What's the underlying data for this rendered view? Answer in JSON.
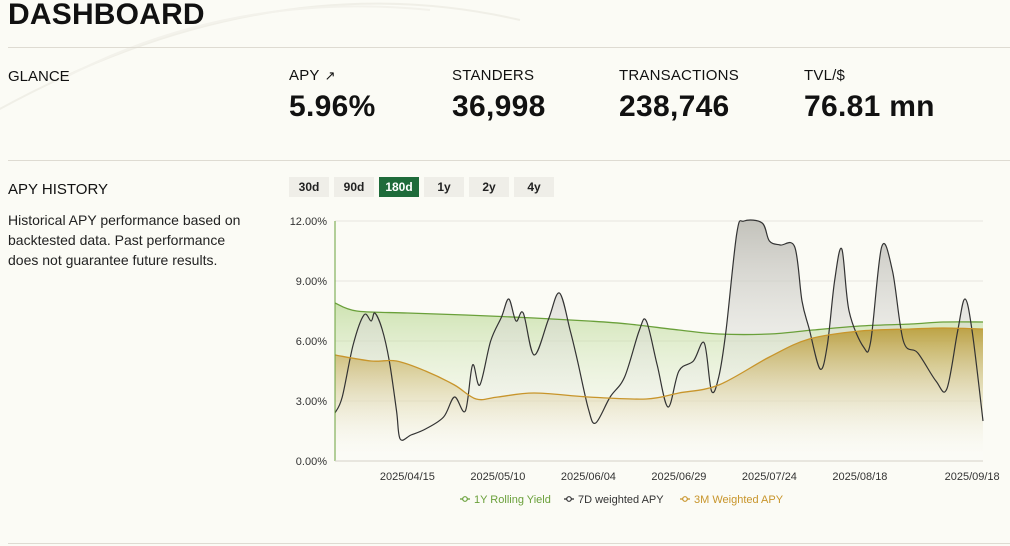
{
  "header": {
    "title": "DASHBOARD"
  },
  "glance": {
    "label": "GLANCE",
    "stats": [
      {
        "label": "APY",
        "icon": "arrow-up-right-icon",
        "value": "5.96%"
      },
      {
        "label": "STANDERS",
        "value": "36,998"
      },
      {
        "label": "TRANSACTIONS",
        "value": "238,746"
      },
      {
        "label": "TVL/$",
        "value": "76.81 mn"
      }
    ]
  },
  "history": {
    "label": "APY HISTORY",
    "description": "Historical APY performance based on backtested data. Past performance does not guarantee future results.",
    "ranges": [
      "30d",
      "90d",
      "180d",
      "1y",
      "2y",
      "4y"
    ],
    "active_range": "180d"
  },
  "colors": {
    "accent": "#1e6b3a",
    "rolling": "#6aa03a",
    "weighted7d": "#333333",
    "weighted3m": "#c8952b"
  },
  "chart_data": {
    "type": "line",
    "x_range": [
      "2025-03-26",
      "2025-09-21"
    ],
    "x_ticks": [
      "2025/04/15",
      "2025/05/10",
      "2025/06/04",
      "2025/06/29",
      "2025/07/24",
      "2025/08/18",
      "2025/09/18"
    ],
    "y_ticks": [
      "0.00%",
      "3.00%",
      "6.00%",
      "9.00%",
      "12.00%"
    ],
    "ylim": [
      0,
      12
    ],
    "legend_position": "bottom",
    "series": [
      {
        "name": "1Y Rolling Yield",
        "points": [
          [
            "2025-03-26",
            7.9
          ],
          [
            "2025-04-01",
            7.5
          ],
          [
            "2025-04-15",
            7.4
          ],
          [
            "2025-05-01",
            7.3
          ],
          [
            "2025-05-20",
            7.15
          ],
          [
            "2025-06-04",
            7.0
          ],
          [
            "2025-06-15",
            6.85
          ],
          [
            "2025-06-29",
            6.55
          ],
          [
            "2025-07-10",
            6.35
          ],
          [
            "2025-07-24",
            6.35
          ],
          [
            "2025-08-05",
            6.55
          ],
          [
            "2025-08-18",
            6.75
          ],
          [
            "2025-09-01",
            6.85
          ],
          [
            "2025-09-10",
            6.95
          ],
          [
            "2025-09-21",
            6.95
          ]
        ]
      },
      {
        "name": "7D weighted APY",
        "points": [
          [
            "2025-03-26",
            2.4
          ],
          [
            "2025-03-28",
            3.2
          ],
          [
            "2025-03-31",
            5.8
          ],
          [
            "2025-04-03",
            7.3
          ],
          [
            "2025-04-05",
            7.0
          ],
          [
            "2025-04-06",
            7.4
          ],
          [
            "2025-04-08",
            6.6
          ],
          [
            "2025-04-10",
            5.0
          ],
          [
            "2025-04-12",
            2.5
          ],
          [
            "2025-04-13",
            1.1
          ],
          [
            "2025-04-16",
            1.3
          ],
          [
            "2025-04-20",
            1.6
          ],
          [
            "2025-04-25",
            2.2
          ],
          [
            "2025-04-28",
            3.2
          ],
          [
            "2025-05-01",
            2.5
          ],
          [
            "2025-05-03",
            4.8
          ],
          [
            "2025-05-05",
            3.8
          ],
          [
            "2025-05-08",
            6.0
          ],
          [
            "2025-05-11",
            7.2
          ],
          [
            "2025-05-13",
            8.1
          ],
          [
            "2025-05-15",
            7.0
          ],
          [
            "2025-05-17",
            7.4
          ],
          [
            "2025-05-20",
            5.3
          ],
          [
            "2025-05-24",
            7.1
          ],
          [
            "2025-05-27",
            8.4
          ],
          [
            "2025-05-30",
            6.5
          ],
          [
            "2025-06-01",
            5.0
          ],
          [
            "2025-06-04",
            2.6
          ],
          [
            "2025-06-06",
            1.9
          ],
          [
            "2025-06-10",
            3.2
          ],
          [
            "2025-06-14",
            4.2
          ],
          [
            "2025-06-18",
            6.5
          ],
          [
            "2025-06-20",
            7.0
          ],
          [
            "2025-06-23",
            4.8
          ],
          [
            "2025-06-26",
            2.7
          ],
          [
            "2025-06-29",
            4.5
          ],
          [
            "2025-07-03",
            5.0
          ],
          [
            "2025-07-06",
            5.9
          ],
          [
            "2025-07-08",
            3.5
          ],
          [
            "2025-07-10",
            4.2
          ],
          [
            "2025-07-12",
            6.5
          ],
          [
            "2025-07-15",
            11.4
          ],
          [
            "2025-07-17",
            12.0
          ],
          [
            "2025-07-22",
            11.9
          ],
          [
            "2025-07-24",
            11.0
          ],
          [
            "2025-07-27",
            10.8
          ],
          [
            "2025-07-31",
            10.7
          ],
          [
            "2025-08-02",
            8.0
          ],
          [
            "2025-08-04",
            6.6
          ],
          [
            "2025-08-07",
            4.6
          ],
          [
            "2025-08-09",
            5.8
          ],
          [
            "2025-08-11",
            9.0
          ],
          [
            "2025-08-13",
            10.6
          ],
          [
            "2025-08-15",
            7.5
          ],
          [
            "2025-08-19",
            5.7
          ],
          [
            "2025-08-21",
            6.0
          ],
          [
            "2025-08-24",
            10.7
          ],
          [
            "2025-08-27",
            9.5
          ],
          [
            "2025-08-30",
            6.0
          ],
          [
            "2025-09-03",
            5.4
          ],
          [
            "2025-09-08",
            4.0
          ],
          [
            "2025-09-11",
            3.6
          ],
          [
            "2025-09-14",
            6.5
          ],
          [
            "2025-09-16",
            8.1
          ],
          [
            "2025-09-18",
            6.5
          ],
          [
            "2025-09-21",
            2.0
          ]
        ]
      },
      {
        "name": "3M Weighted APY",
        "points": [
          [
            "2025-03-26",
            5.3
          ],
          [
            "2025-04-05",
            5.0
          ],
          [
            "2025-04-12",
            5.0
          ],
          [
            "2025-04-20",
            4.5
          ],
          [
            "2025-04-28",
            3.8
          ],
          [
            "2025-05-04",
            3.1
          ],
          [
            "2025-05-10",
            3.2
          ],
          [
            "2025-05-20",
            3.4
          ],
          [
            "2025-06-04",
            3.2
          ],
          [
            "2025-06-20",
            3.1
          ],
          [
            "2025-06-29",
            3.4
          ],
          [
            "2025-07-10",
            3.8
          ],
          [
            "2025-07-24",
            5.2
          ],
          [
            "2025-08-04",
            6.1
          ],
          [
            "2025-08-18",
            6.5
          ],
          [
            "2025-09-01",
            6.6
          ],
          [
            "2025-09-10",
            6.65
          ],
          [
            "2025-09-21",
            6.6
          ]
        ]
      }
    ]
  }
}
